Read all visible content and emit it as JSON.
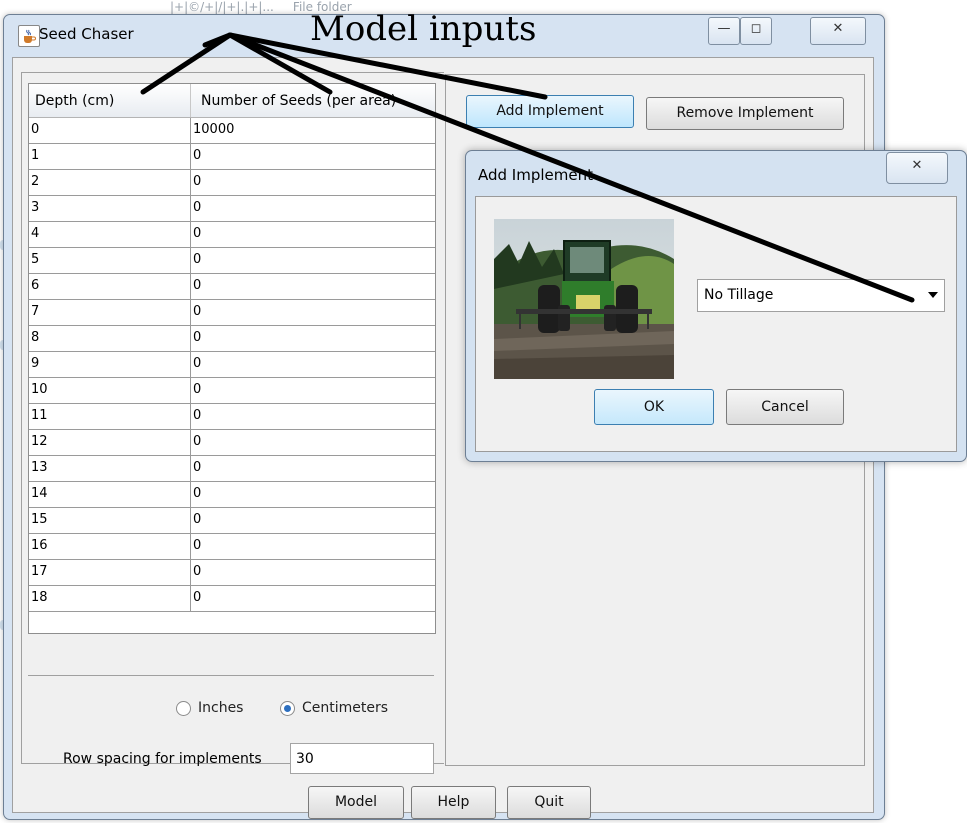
{
  "background": {
    "strip_text": "|+|©/+|/|+|.|+|...     File folder"
  },
  "window": {
    "title": "Seed Chaser",
    "icon": "java-cup-icon",
    "controls": {
      "minimize": "—",
      "maximize": "◻",
      "close": "✕"
    }
  },
  "annotation": {
    "title": "Model inputs"
  },
  "table": {
    "headers": [
      "Depth (cm)",
      "Number of Seeds (per area)"
    ],
    "rows": [
      [
        "0",
        "10000"
      ],
      [
        "1",
        "0"
      ],
      [
        "2",
        "0"
      ],
      [
        "3",
        "0"
      ],
      [
        "4",
        "0"
      ],
      [
        "5",
        "0"
      ],
      [
        "6",
        "0"
      ],
      [
        "7",
        "0"
      ],
      [
        "8",
        "0"
      ],
      [
        "9",
        "0"
      ],
      [
        "10",
        "0"
      ],
      [
        "11",
        "0"
      ],
      [
        "12",
        "0"
      ],
      [
        "13",
        "0"
      ],
      [
        "14",
        "0"
      ],
      [
        "15",
        "0"
      ],
      [
        "16",
        "0"
      ],
      [
        "17",
        "0"
      ],
      [
        "18",
        "0"
      ]
    ]
  },
  "units": {
    "options": [
      "Inches",
      "Centimeters"
    ],
    "selected": "Centimeters"
  },
  "row_spacing": {
    "label": "Row spacing for implements",
    "value": "30"
  },
  "implement_buttons": {
    "add": "Add Implement",
    "remove": "Remove Implement"
  },
  "bottom_buttons": {
    "model": "Model",
    "help": "Help",
    "quit": "Quit"
  },
  "dialog": {
    "title": "Add Implement",
    "close": "✕",
    "image": "tractor-photo",
    "select_value": "No Tillage",
    "ok": "OK",
    "cancel": "Cancel"
  },
  "colors": {
    "accent": "#3c7fb1",
    "window_frame": "#d6e3f2"
  }
}
